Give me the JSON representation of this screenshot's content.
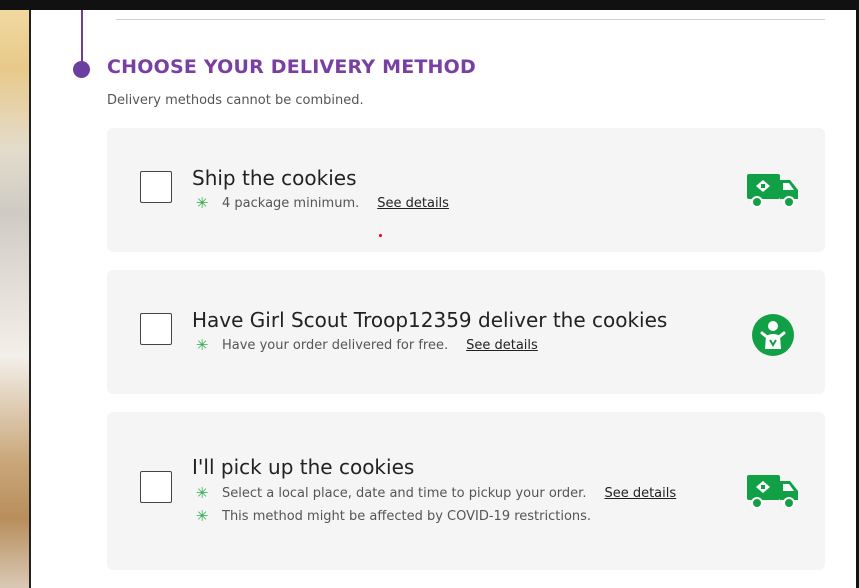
{
  "section": {
    "title": "CHOOSE YOUR DELIVERY METHOD",
    "subtitle": "Delivery methods cannot be combined."
  },
  "options": [
    {
      "title": "Ship the cookies",
      "notes": [
        "4 package minimum."
      ],
      "link": "See details",
      "icon": "truck-icon",
      "checked": false
    },
    {
      "title": "Have Girl Scout Troop12359 deliver the cookies",
      "notes": [
        "Have your order delivered for free."
      ],
      "link": "See details",
      "icon": "girl-scout-icon",
      "checked": false
    },
    {
      "title": "I'll pick up the cookies",
      "notes": [
        "Select a local place, date and time to pickup your order.",
        "This method might be affected by COVID-19 restrictions."
      ],
      "link": "See details",
      "icon": "truck-icon",
      "checked": false
    }
  ],
  "colors": {
    "accent_purple": "#7a3fa2",
    "icon_green": "#12a046",
    "note_star_green": "#2eaa4a",
    "card_bg": "#f5f5f5"
  }
}
